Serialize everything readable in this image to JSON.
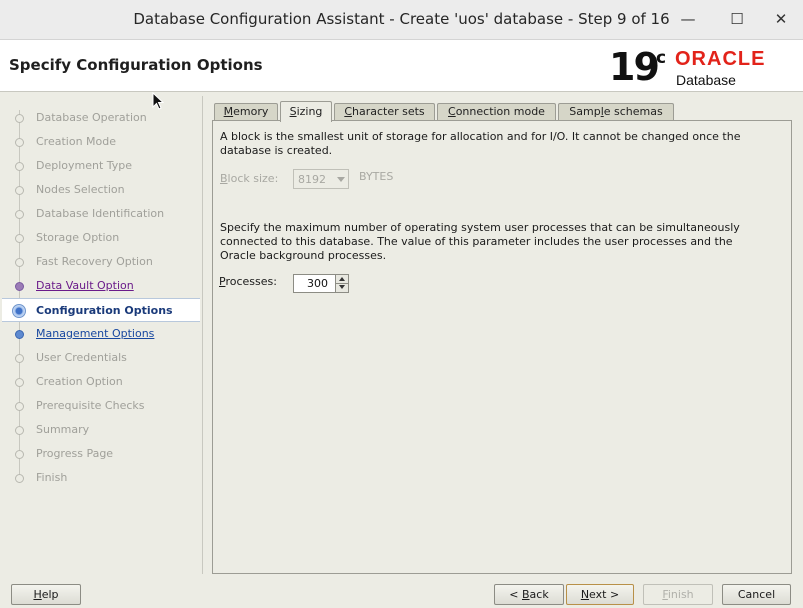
{
  "window": {
    "title": "Database Configuration Assistant - Create 'uos' database - Step 9 of 16",
    "minimize_glyph": "—",
    "maximize_glyph": "☐",
    "close_glyph": "✕"
  },
  "header": {
    "page_title": "Specify Configuration Options",
    "brand_version": "19",
    "brand_version_sup": "c",
    "brand_name": "ORACLE",
    "brand_product": "Database"
  },
  "nav": {
    "items": [
      {
        "label": "Database Operation",
        "state": "disabled"
      },
      {
        "label": "Creation Mode",
        "state": "disabled"
      },
      {
        "label": "Deployment Type",
        "state": "disabled"
      },
      {
        "label": "Nodes Selection",
        "state": "disabled"
      },
      {
        "label": "Database Identification",
        "state": "disabled"
      },
      {
        "label": "Storage Option",
        "state": "disabled"
      },
      {
        "label": "Fast Recovery Option",
        "state": "disabled"
      },
      {
        "label": "Data Vault Option",
        "state": "visited"
      },
      {
        "label": "Configuration Options",
        "state": "current"
      },
      {
        "label": "Management Options",
        "state": "link"
      },
      {
        "label": "User Credentials",
        "state": "disabled"
      },
      {
        "label": "Creation Option",
        "state": "disabled"
      },
      {
        "label": "Prerequisite Checks",
        "state": "disabled"
      },
      {
        "label": "Summary",
        "state": "disabled"
      },
      {
        "label": "Progress Page",
        "state": "disabled"
      },
      {
        "label": "Finish",
        "state": "disabled"
      }
    ]
  },
  "tabs": {
    "memory": {
      "pre": "",
      "u": "M",
      "post": "emory"
    },
    "sizing": {
      "pre": "",
      "u": "S",
      "post": "izing"
    },
    "charsets": {
      "pre": "",
      "u": "C",
      "post": "haracter sets"
    },
    "connection": {
      "pre": "",
      "u": "C",
      "post": "onnection mode"
    },
    "samples": {
      "pre": "Samp",
      "u": "l",
      "post": "e schemas"
    },
    "active": "Sizing"
  },
  "sizing": {
    "block_text_1": "A block is the smallest unit of storage for allocation and for I/O. It cannot be changed once the",
    "block_text_2": "database is created.",
    "block_size_label_pre": "",
    "block_size_label_u": "B",
    "block_size_label_post": "lock size:",
    "block_size_value": "8192",
    "block_size_unit": "BYTES",
    "process_text_1": "Specify the maximum number of operating system user processes that can be simultaneously",
    "process_text_2": "connected to this database. The value of this parameter includes the user processes and the",
    "process_text_3": "Oracle background processes.",
    "processes_label_pre": "",
    "processes_label_u": "P",
    "processes_label_post": "rocesses:",
    "processes_value": "300"
  },
  "buttons": {
    "help": {
      "pre": "",
      "u": "H",
      "post": "elp"
    },
    "back": {
      "pre": "< ",
      "u": "B",
      "post": "ack"
    },
    "next": {
      "pre": "",
      "u": "N",
      "post": "ext >"
    },
    "finish": {
      "pre": "",
      "u": "F",
      "post": "inish"
    },
    "cancel": {
      "pre": "",
      "u": "",
      "post": "Cancel"
    }
  }
}
